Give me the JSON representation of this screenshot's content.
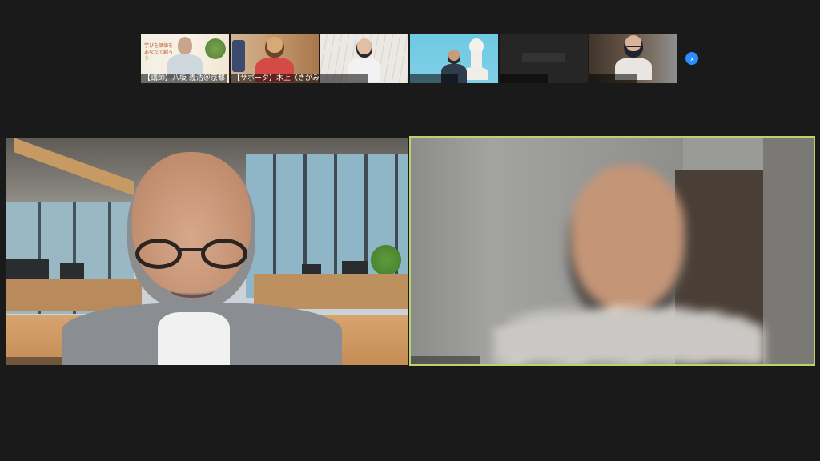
{
  "window": {
    "background": "#1a1a1a",
    "active_speaker_border": "#b9d46a",
    "accent": "#2d8cff"
  },
  "thumbnails": [
    {
      "label": "【講師】八坂 義浩＠京都",
      "name_key": "thumb-yasaka"
    },
    {
      "label": "【サポータ】木上（きがみ）...",
      "name_key": "thumb-kigami"
    },
    {
      "label": "",
      "name_key": "thumb-3"
    },
    {
      "label": "",
      "name_key": "thumb-4"
    },
    {
      "label": "",
      "name_key": "thumb-5"
    },
    {
      "label": "",
      "name_key": "thumb-6"
    }
  ],
  "slide_in_thumb": {
    "text": "学びを価値を\nあなたで創ろう"
  },
  "navigation": {
    "next_icon": "chevron-right-icon",
    "next_glyph": "›"
  },
  "main_tiles": [
    {
      "name_key": "tile-main-left",
      "label": ""
    },
    {
      "name_key": "tile-main-right",
      "label": ""
    }
  ]
}
